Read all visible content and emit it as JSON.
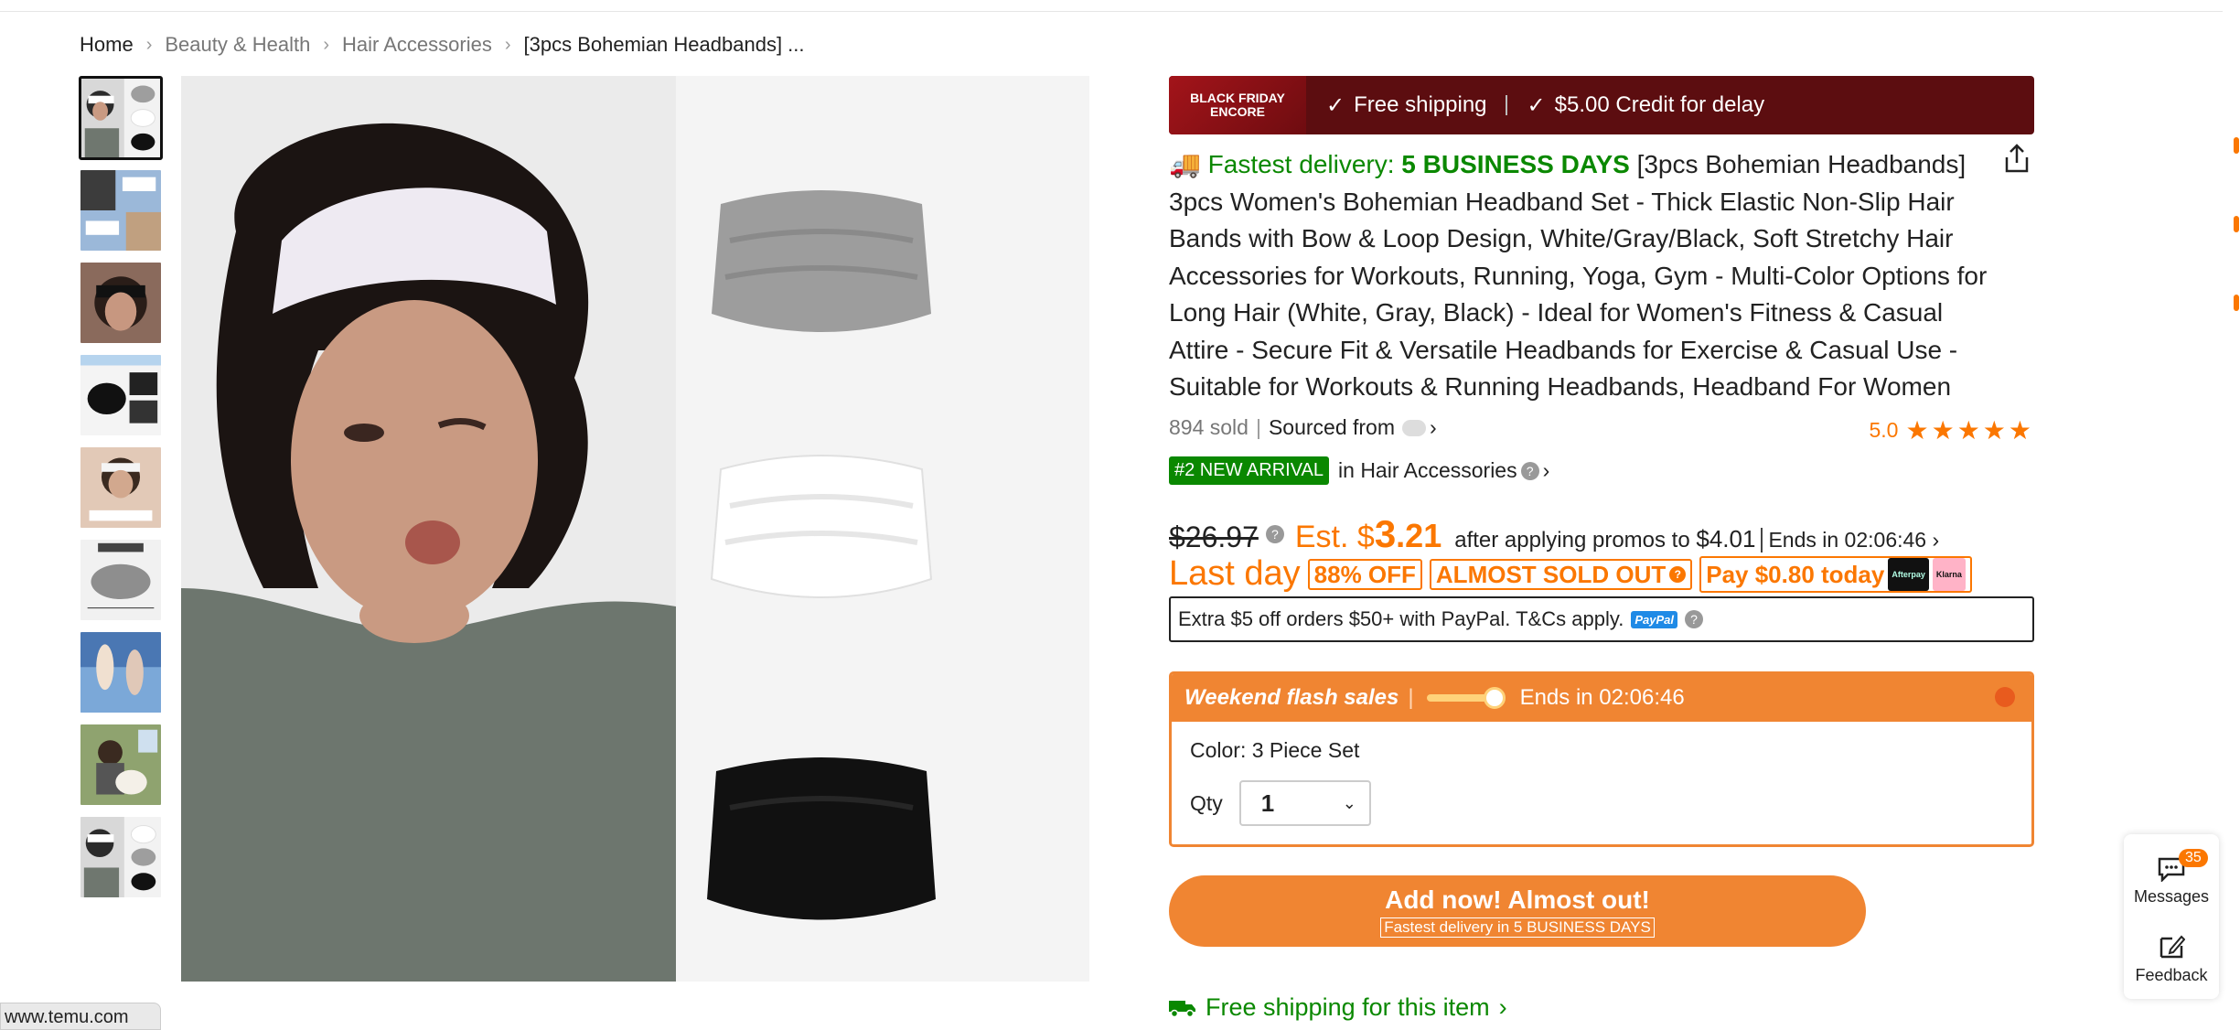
{
  "breadcrumb": {
    "home": "Home",
    "cat1": "Beauty & Health",
    "cat2": "Hair Accessories",
    "current": "[3pcs Bohemian Headbands] ..."
  },
  "promo": {
    "badge_line1": "BLACK FRIDAY",
    "badge_line2": "ENCORE",
    "free_shipping": "Free shipping",
    "credit": "$5.00 Credit for delay"
  },
  "title": {
    "fast_prefix": "Fastest delivery:",
    "fast_days": "5 BUSINESS DAYS",
    "text": "[3pcs Bohemian Headbands] 3pcs Women's Bohemian Headband Set - Thick Elastic Non-Slip Hair Bands with Bow & Loop Design, White/Gray/Black, Soft Stretchy Hair Accessories for Workouts, Running, Yoga, Gym - Multi-Color Options for Long Hair (White, Gray, Black) - Ideal for Women's Fitness & Casual Attire - Secure Fit & Versatile Headbands for Exercise & Casual Use - Suitable for Workouts & Running Headbands, Headband For Women"
  },
  "stats": {
    "sold": "894 sold",
    "sourced": "Sourced from",
    "rating": "5.0",
    "stars": "★★★★★"
  },
  "arrival": {
    "badge": "#2 NEW ARRIVAL",
    "category": "in Hair Accessories"
  },
  "price": {
    "original": "$26.97",
    "est_prefix": "Est. $",
    "est_dollars": "3",
    "est_cents": ".21",
    "after_text": "after applying promos to",
    "after_amount": "$4.01",
    "ends": "Ends in 02:06:46"
  },
  "tags": {
    "last_day": "Last day",
    "off": "88% OFF",
    "almost_sold": "ALMOST SOLD OUT",
    "pay": "Pay $0.80 today",
    "afterpay": "Afterpay",
    "klarna": "Klarna"
  },
  "paypal": {
    "text": "Extra $5 off orders $50+ with PayPal. T&Cs apply.",
    "logo": "PayPal"
  },
  "flash": {
    "title": "Weekend flash sales",
    "ends": "Ends in 02:06:46",
    "color_label": "Color: 3 Piece Set",
    "qty_label": "Qty",
    "qty_value": "1"
  },
  "cta": {
    "main": "Add now! Almost out!",
    "sub": "Fastest delivery in 5 BUSINESS DAYS"
  },
  "shipping": {
    "text": "Free shipping for this item"
  },
  "side": {
    "messages": "Messages",
    "messages_count": "35",
    "feedback": "Feedback"
  },
  "url_tip": "www.temu.com",
  "colors": {
    "accent": "#fb7701",
    "green": "#0a8800",
    "promo_bg": "#5c0d10",
    "flash": "#f08532"
  }
}
